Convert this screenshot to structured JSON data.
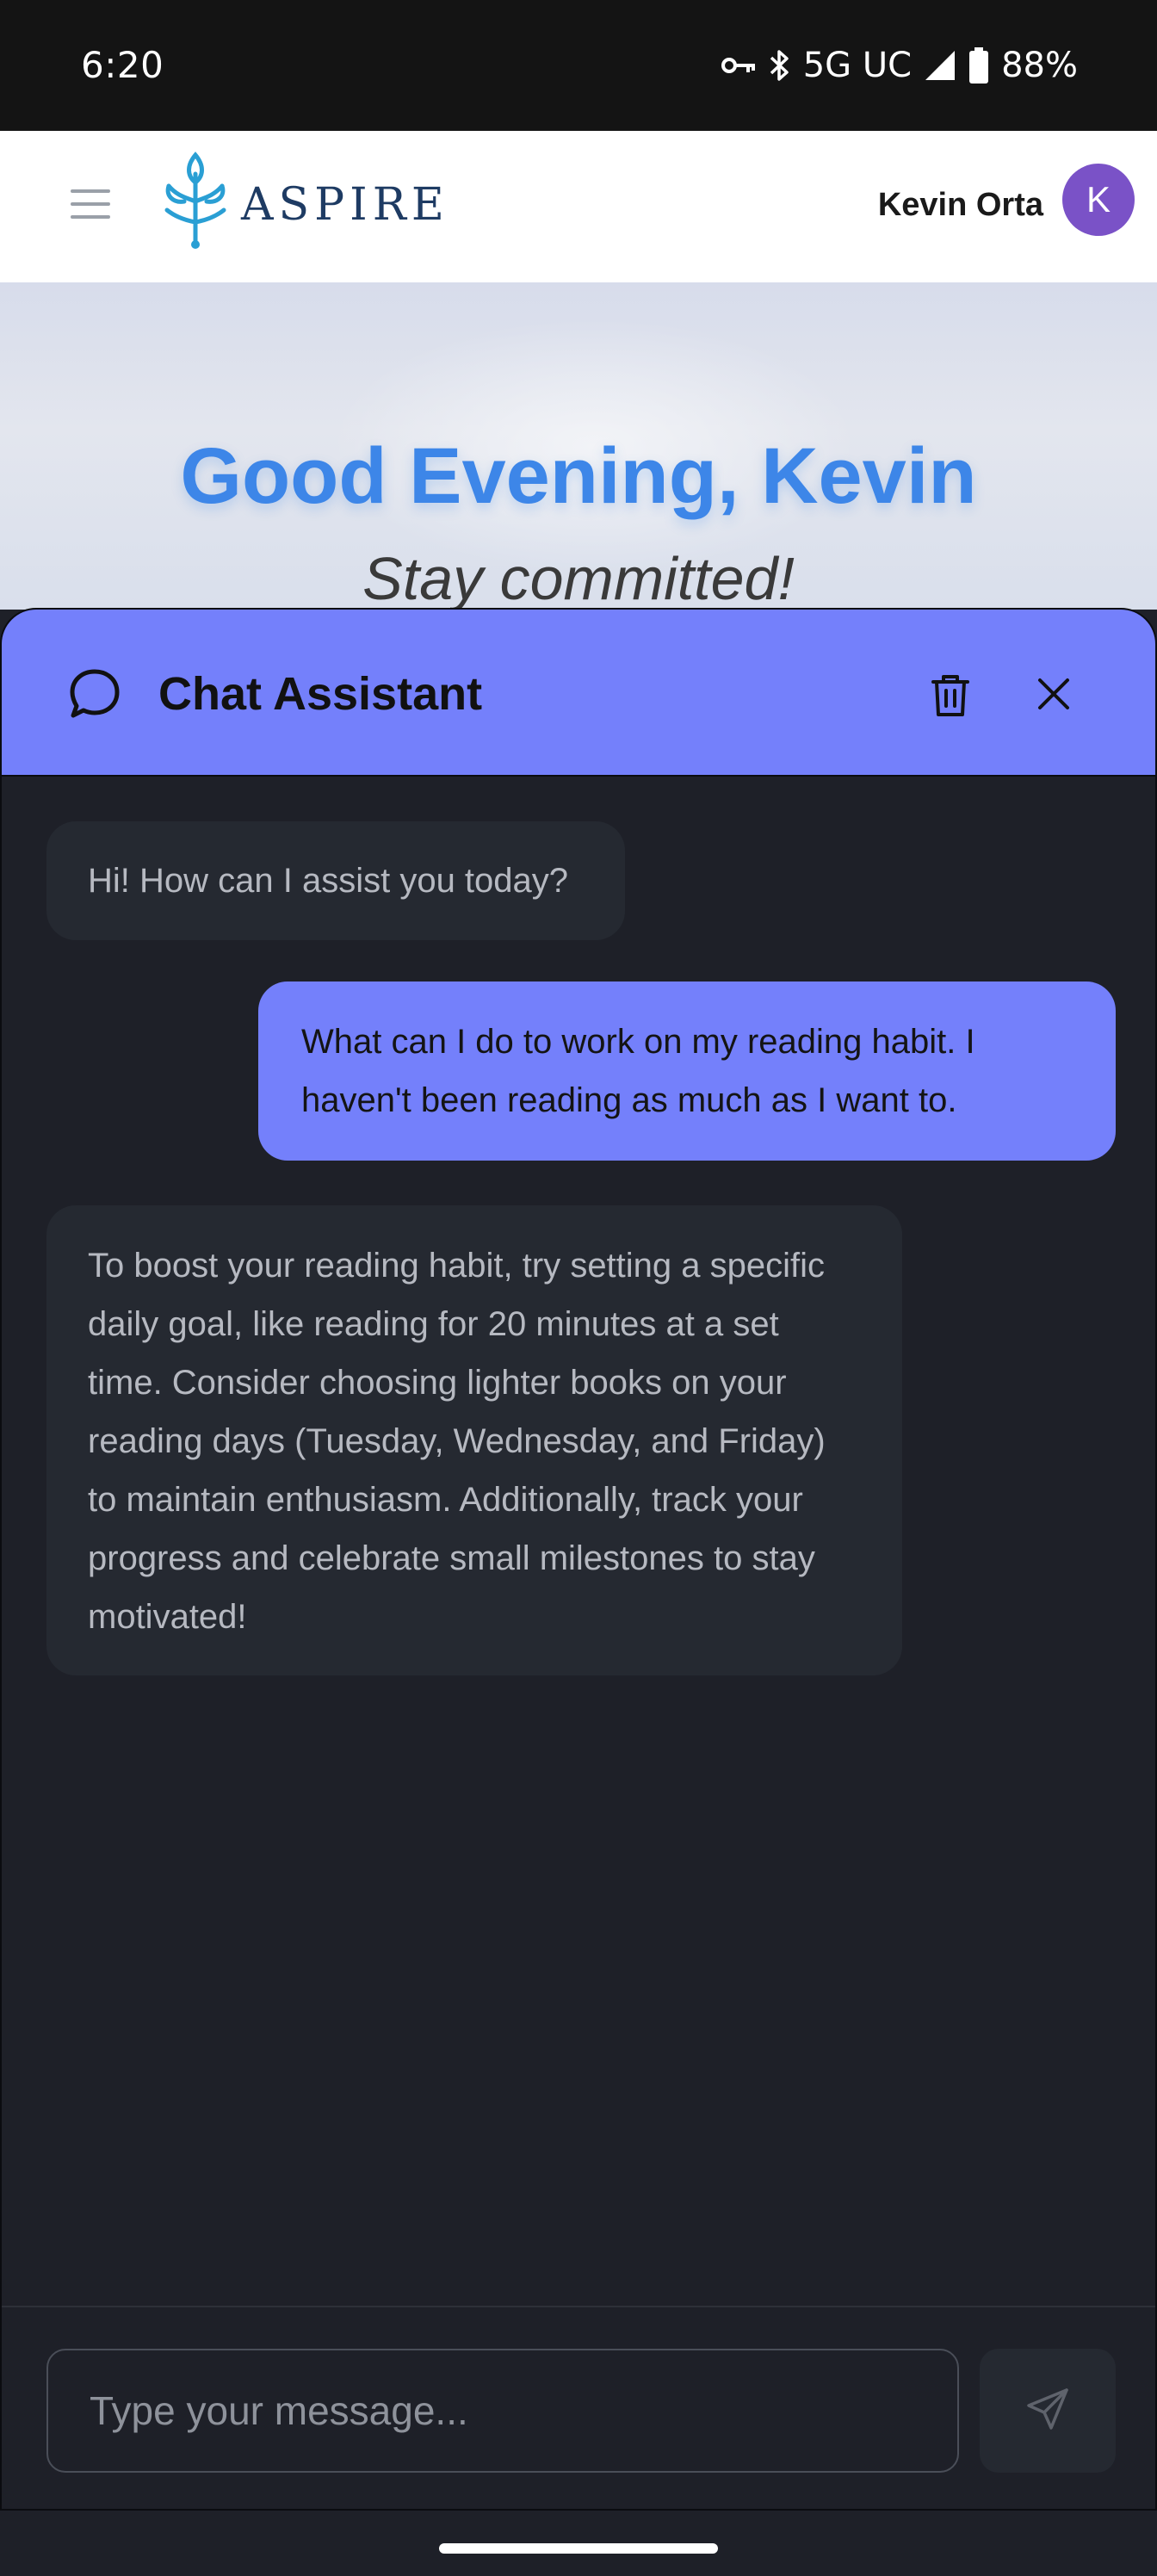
{
  "status_bar": {
    "time": "6:20",
    "network": "5G UC",
    "battery": "88%",
    "icons": [
      "vpn-key-icon",
      "bluetooth-icon",
      "signal-icon",
      "battery-icon"
    ]
  },
  "header": {
    "logo_text": "ASPIRE",
    "user_name": "Kevin Orta",
    "avatar_initial": "K",
    "brand_color": "#1e3b63",
    "avatar_color": "#7a52c7"
  },
  "hero": {
    "greeting": "Good Evening, Kevin",
    "subtitle": "Stay committed!",
    "greeting_color": "#3d86e8"
  },
  "chat": {
    "title": "Chat Assistant",
    "header_color": "#7480fb",
    "messages": [
      {
        "role": "assistant",
        "text": "Hi! How can I assist you today?"
      },
      {
        "role": "user",
        "text": "What can I do to work on my reading habit. I haven't been reading as much as I want to."
      },
      {
        "role": "assistant",
        "text": "To boost your reading habit, try setting a specific daily goal, like reading for 20 minutes at a set time. Consider choosing lighter books on your reading days (Tuesday, Wednesday, and Friday) to maintain enthusiasm. Additionally, track your progress and celebrate small milestones to stay motivated!"
      }
    ],
    "input_placeholder": "Type your message...",
    "input_value": ""
  }
}
